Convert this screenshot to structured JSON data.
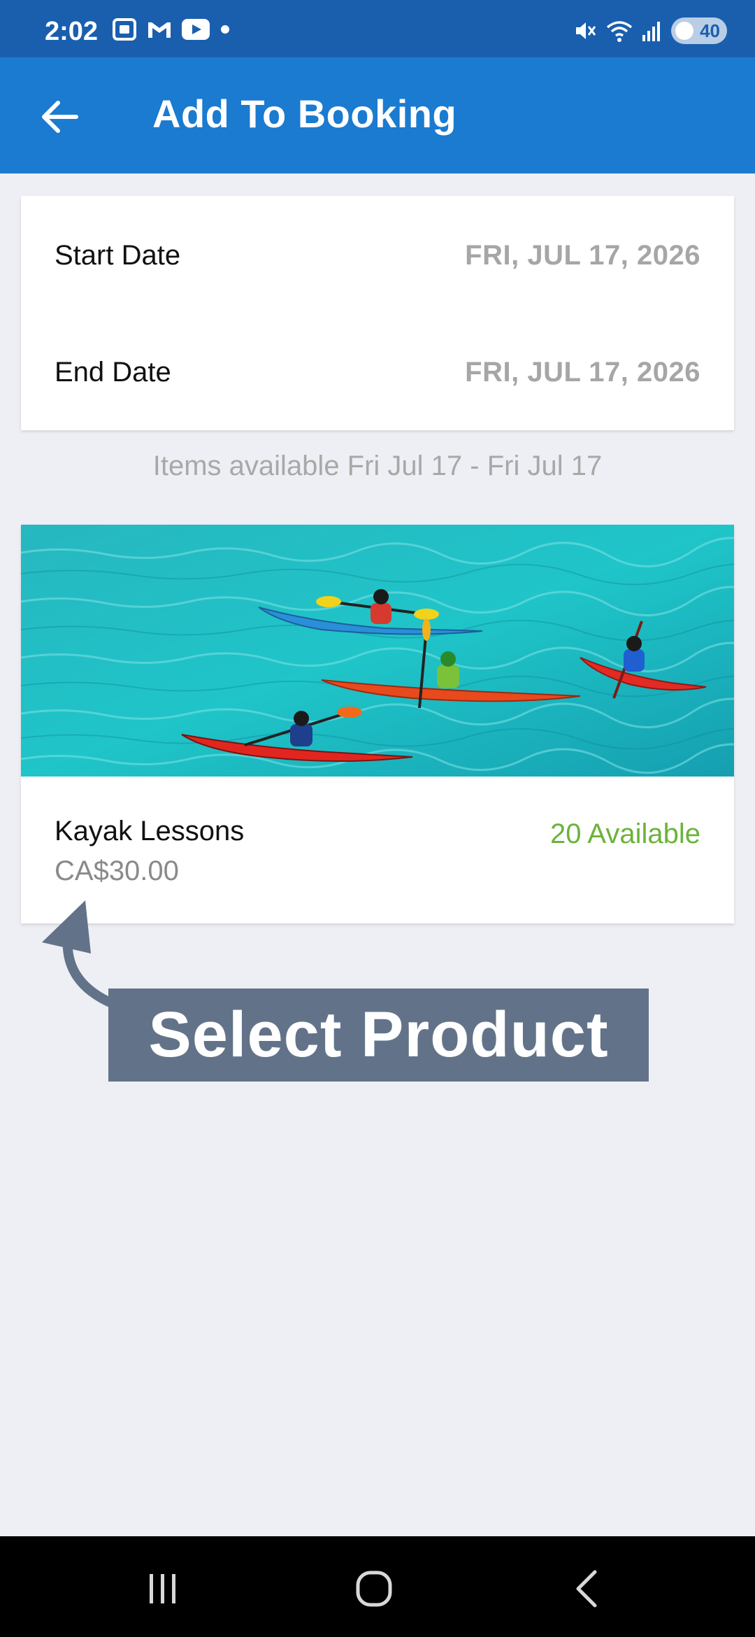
{
  "status": {
    "time": "2:02",
    "battery": "40",
    "icons": [
      "screenshot-icon",
      "gmail-icon",
      "youtube-icon",
      "dot-icon",
      "mute-icon",
      "wifi-icon",
      "signal-icon",
      "battery-icon"
    ]
  },
  "appbar": {
    "title": "Add To Booking",
    "back_icon": "arrow-back-icon"
  },
  "dates": {
    "start_label": "Start Date",
    "start_value": "FRI, JUL 17, 2026",
    "end_label": "End Date",
    "end_value": "FRI, JUL 17, 2026"
  },
  "availability_note": "Items available Fri Jul 17 - Fri Jul 17",
  "product": {
    "name": "Kayak Lessons",
    "price": "CA$30.00",
    "available": "20 Available",
    "image": "kayakers-on-turquoise-water"
  },
  "callout": {
    "text": "Select Product"
  },
  "navbar": {
    "recents_icon": "recents-icon",
    "home_icon": "home-icon",
    "back_icon": "nav-back-icon"
  },
  "colors": {
    "status_bar": "#1a5fae",
    "app_bar": "#1a7bd0",
    "available_green": "#6bb33a",
    "callout_bg": "#627389"
  }
}
